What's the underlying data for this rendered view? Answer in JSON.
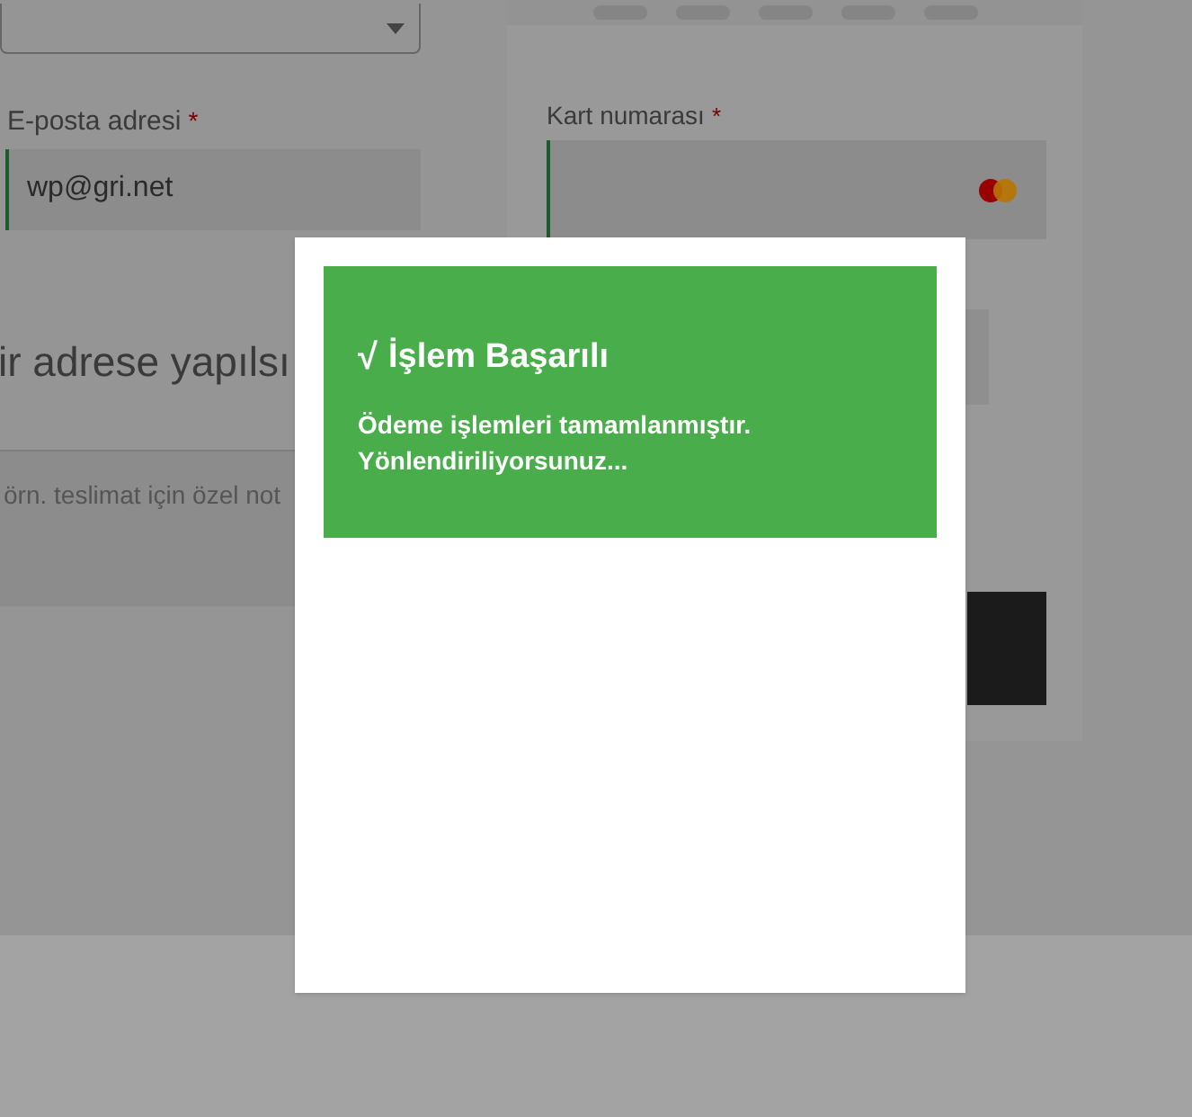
{
  "billing": {
    "email_field": {
      "label": "E-posta adresi",
      "required_mark": "*",
      "value": "wp@gri.net"
    },
    "shipping_heading": "ir adrese yapılsı",
    "notes_field": {
      "placeholder": "örn. teslimat için özel not"
    }
  },
  "payment": {
    "card_number_field": {
      "label": "Kart numarası",
      "required_mark": "*"
    }
  },
  "modal": {
    "check": "√",
    "title": "İşlem Başarılı",
    "message": "Ödeme işlemleri tamamlanmıştır.",
    "message_2": "Yönlendiriliyorsunuz..."
  }
}
